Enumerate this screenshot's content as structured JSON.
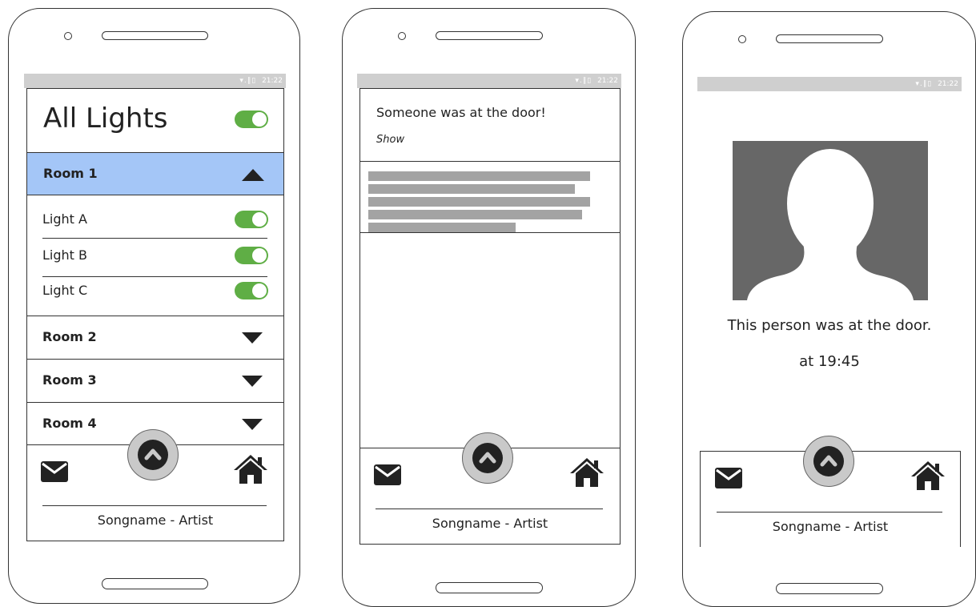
{
  "status_bar": {
    "signal_icons": "▾.∥▯",
    "time": "21:22"
  },
  "phone1": {
    "title": "All Lights",
    "rooms": [
      {
        "label": "Room 1",
        "expanded": true
      },
      {
        "label": "Room 2",
        "expanded": false
      },
      {
        "label": "Room 3",
        "expanded": false
      },
      {
        "label": "Room 4",
        "expanded": false
      }
    ],
    "lights": [
      {
        "label": "Light A",
        "on": true
      },
      {
        "label": "Light B",
        "on": true
      },
      {
        "label": "Light C",
        "on": true
      }
    ],
    "song": "Songname - Artist"
  },
  "phone2": {
    "notification_title": "Someone was at the door!",
    "notification_action": "Show",
    "song": "Songname - Artist"
  },
  "phone3": {
    "caption": "This person was at the door.",
    "time_text": "at 19:45",
    "song": "Songname - Artist"
  },
  "colors": {
    "toggle_on": "#5fae45",
    "selected_room": "#a4c6f7",
    "status_bar": "#cfcfcf",
    "avatar_bg": "#676767"
  },
  "icons": [
    "mail-icon",
    "home-icon",
    "chevron-up-icon",
    "triangle-up-icon",
    "triangle-down-icon",
    "person-silhouette-icon"
  ]
}
